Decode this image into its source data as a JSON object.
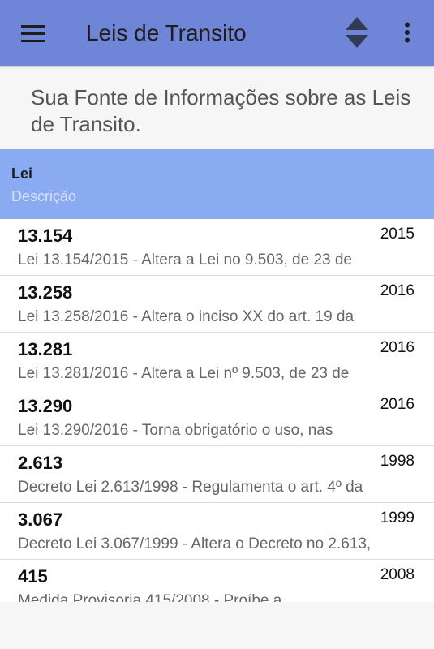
{
  "app_bar": {
    "title": "Leis de Transito",
    "menu_icon": "hamburger-menu-icon",
    "sort_icon": "sort-up-down-icon",
    "overflow_icon": "more-vertical-icon",
    "color": "#6f86d8"
  },
  "subtitle": "Sua Fonte de Informações sobre as Leis de Transito.",
  "header": {
    "title": "Lei",
    "placeholder": "Descrição",
    "color": "#8aaaf1"
  },
  "laws": [
    {
      "number": "13.154",
      "year": "2015",
      "description": "Lei 13.154/2015 - Altera a Lei no 9.503, de 23 de"
    },
    {
      "number": "13.258",
      "year": "2016",
      "description": "Lei 13.258/2016 - Altera o inciso XX do art. 19 da"
    },
    {
      "number": "13.281",
      "year": "2016",
      "description": "Lei 13.281/2016 - Altera a Lei nº 9.503, de 23 de"
    },
    {
      "number": "13.290",
      "year": "2016",
      "description": "Lei 13.290/2016 - Torna obrigatório o uso, nas"
    },
    {
      "number": "2.613",
      "year": "1998",
      "description": "Decreto Lei 2.613/1998 - Regulamenta o art. 4º da"
    },
    {
      "number": "3.067",
      "year": "1999",
      "description": "Decreto Lei 3.067/1999 - Altera o Decreto no 2.613,"
    },
    {
      "number": "415",
      "year": "2008",
      "description": "Medida Provisoria 415/2008 - Proíbe a"
    }
  ]
}
